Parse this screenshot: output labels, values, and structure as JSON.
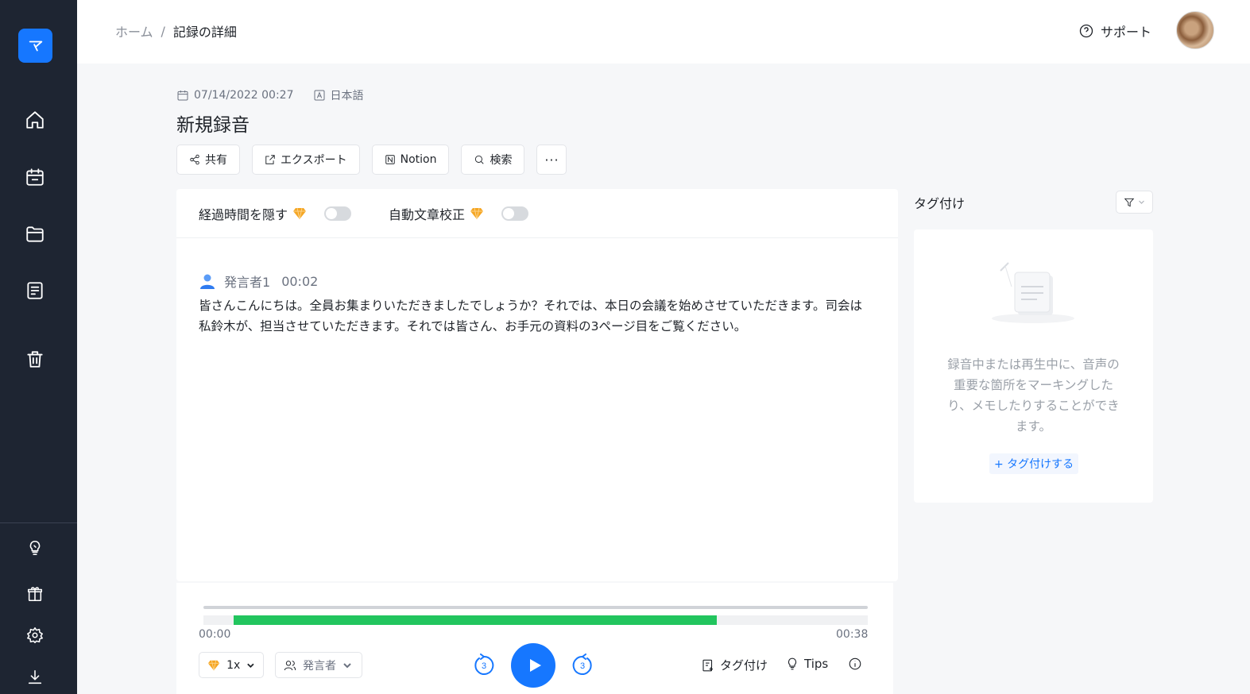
{
  "breadcrumb": {
    "home": "ホーム",
    "separator": "/",
    "current": "記録の詳細"
  },
  "header": {
    "support_label": "サポート"
  },
  "meta": {
    "datetime": "07/14/2022 00:27",
    "language": "日本語"
  },
  "title": "新規録音",
  "toolbar": {
    "share": "共有",
    "export": "エクスポート",
    "notion": "Notion",
    "search": "検索",
    "more": "···"
  },
  "options": {
    "hide_elapsed": "経過時間を隠す",
    "auto_correct": "自動文章校正"
  },
  "transcript": {
    "speaker": "発言者1",
    "time": "00:02",
    "text": "皆さんこんにちは。全員お集まりいただきましたでしょうか？それでは、本日の会議を始めさせていただきます。司会は私鈴木が、担当させていただきます。それでは皆さん、お手元の資料の3ページ目をご覧ください。"
  },
  "player": {
    "time_start": "00:00",
    "time_end": "00:38",
    "speed": "1x",
    "speaker_select": "発言者",
    "skip_back": "3",
    "skip_forward": "3",
    "tag_label": "タグ付け",
    "tips_label": "Tips",
    "wave_start": 0.045,
    "wave_end": 0.773
  },
  "tag_panel": {
    "title": "タグ付け",
    "empty_text": "録音中または再生中に、音声の重要な箇所をマーキングしたり、メモしたりすることができます。",
    "add_label": "+ タグ付けする"
  },
  "colors": {
    "accent": "#1677ff",
    "sidebar": "#1e2532",
    "progress": "#22c55e",
    "gem": "#f5a623"
  }
}
